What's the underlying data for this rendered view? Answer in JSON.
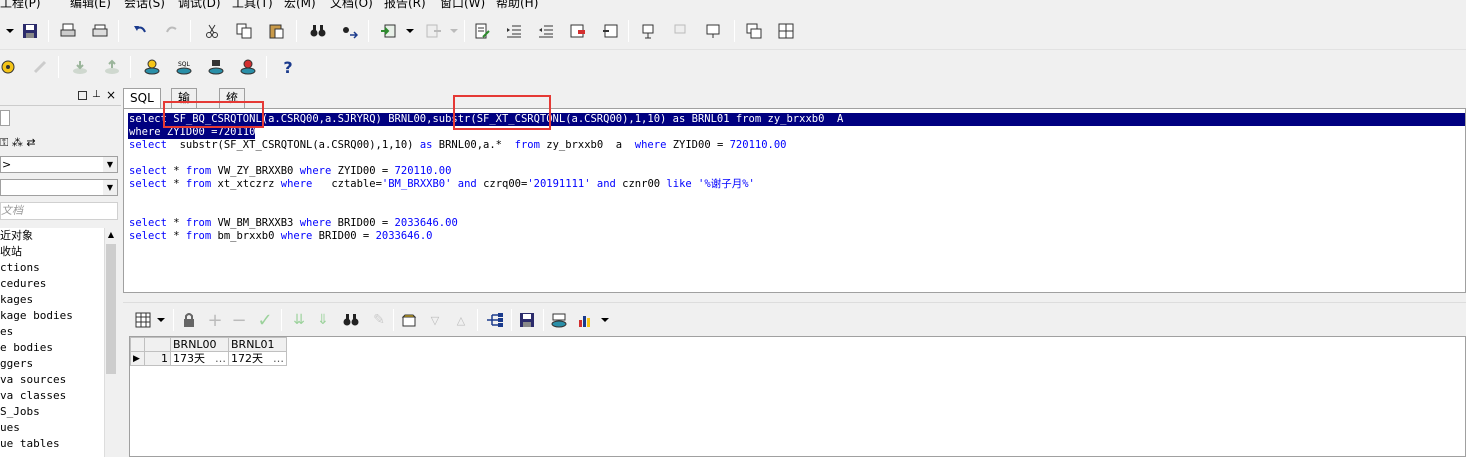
{
  "menu": [
    "工程(P)",
    "编辑(E)",
    "会话(S)",
    "调试(D)",
    "工具(T)",
    "宏(M)",
    "文档(O)",
    "报告(R)",
    "窗口(W)",
    "帮助(H)"
  ],
  "left_panel": {
    "combo1_value": ">",
    "combo2_value": "",
    "filter_placeholder": "文档",
    "items": [
      "近对象",
      "收站",
      "ctions",
      "cedures",
      "kages",
      "kage bodies",
      "es",
      "e bodies",
      "ggers",
      "va sources",
      "va classes",
      "S_Jobs",
      "ues",
      "ue tables"
    ]
  },
  "tabs": [
    "SQL",
    "输出",
    "统计表"
  ],
  "sql_lines": [
    {
      "text": "select SF_BQ_CSRQTONL(a.CSRQ00,a.SJRYRQ) BRNL00,substr(SF_XT_CSRQTONL(a.CSRQ00),1,10) as BRNL01 from zy_brxxb0  A",
      "selected": true
    },
    {
      "text": "where ZYID00 =720110",
      "selected": true
    },
    {
      "text": "select  substr(SF_XT_CSRQTONL(a.CSRQ00),1,10) as BRNL00,a.*  from zy_brxxb0  a  where ZYID00 = 720110.00",
      "selected": false
    },
    {
      "text": "",
      "selected": false
    },
    {
      "text": "select * from VW_ZY_BRXXB0 where ZYID00 = 720110.00",
      "selected": false
    },
    {
      "text": "select * from xt_xtczrz where   cztable='BM_BRXXB0' and czrq00='20191111' and cznr00 like '%谢子月%'",
      "selected": false
    },
    {
      "text": "",
      "selected": false
    },
    {
      "text": "",
      "selected": false
    },
    {
      "text": "select * from VW_BM_BRXXB3 where BRID00 = 2033646.00",
      "selected": false
    },
    {
      "text": "select * from bm_brxxb0 where BRID00 = 2033646.0",
      "selected": false
    }
  ],
  "results": {
    "columns": [
      "BRNL00",
      "BRNL01"
    ],
    "rows": [
      {
        "num": "1",
        "cells": [
          "173天",
          "172天"
        ]
      }
    ],
    "ellipsis": "…"
  },
  "help_label": "?",
  "colors": {
    "selection": "#000080",
    "keyword": "#0000ff",
    "highlight_box": "#e53935"
  }
}
